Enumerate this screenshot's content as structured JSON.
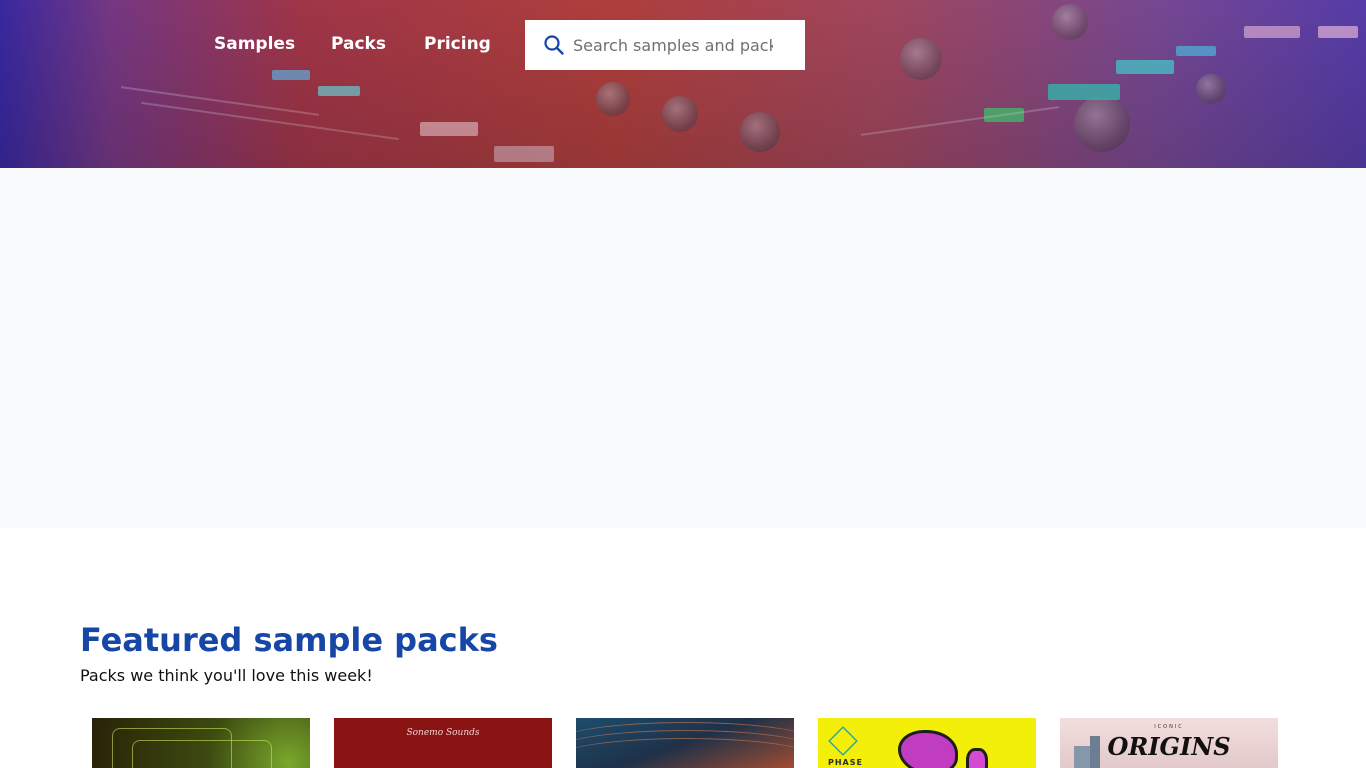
{
  "nav": {
    "samples": "Samples",
    "packs": "Packs",
    "pricing": "Pricing"
  },
  "search": {
    "placeholder": "Search samples and packs",
    "icon": "search-icon"
  },
  "featured": {
    "title": "Featured sample packs",
    "subtitle": "Packs we think you'll love this week!",
    "packs": [
      {
        "cover_text": ""
      },
      {
        "cover_text": "Sonemo Sounds"
      },
      {
        "cover_text": ""
      },
      {
        "cover_text": "PHASE"
      },
      {
        "cover_text": "ORIGINS",
        "cover_subtext": "ICONIC"
      }
    ]
  },
  "colors": {
    "heading": "#1747a6",
    "banner_bg": "#f9fafc",
    "search_icon": "#1747a6"
  }
}
